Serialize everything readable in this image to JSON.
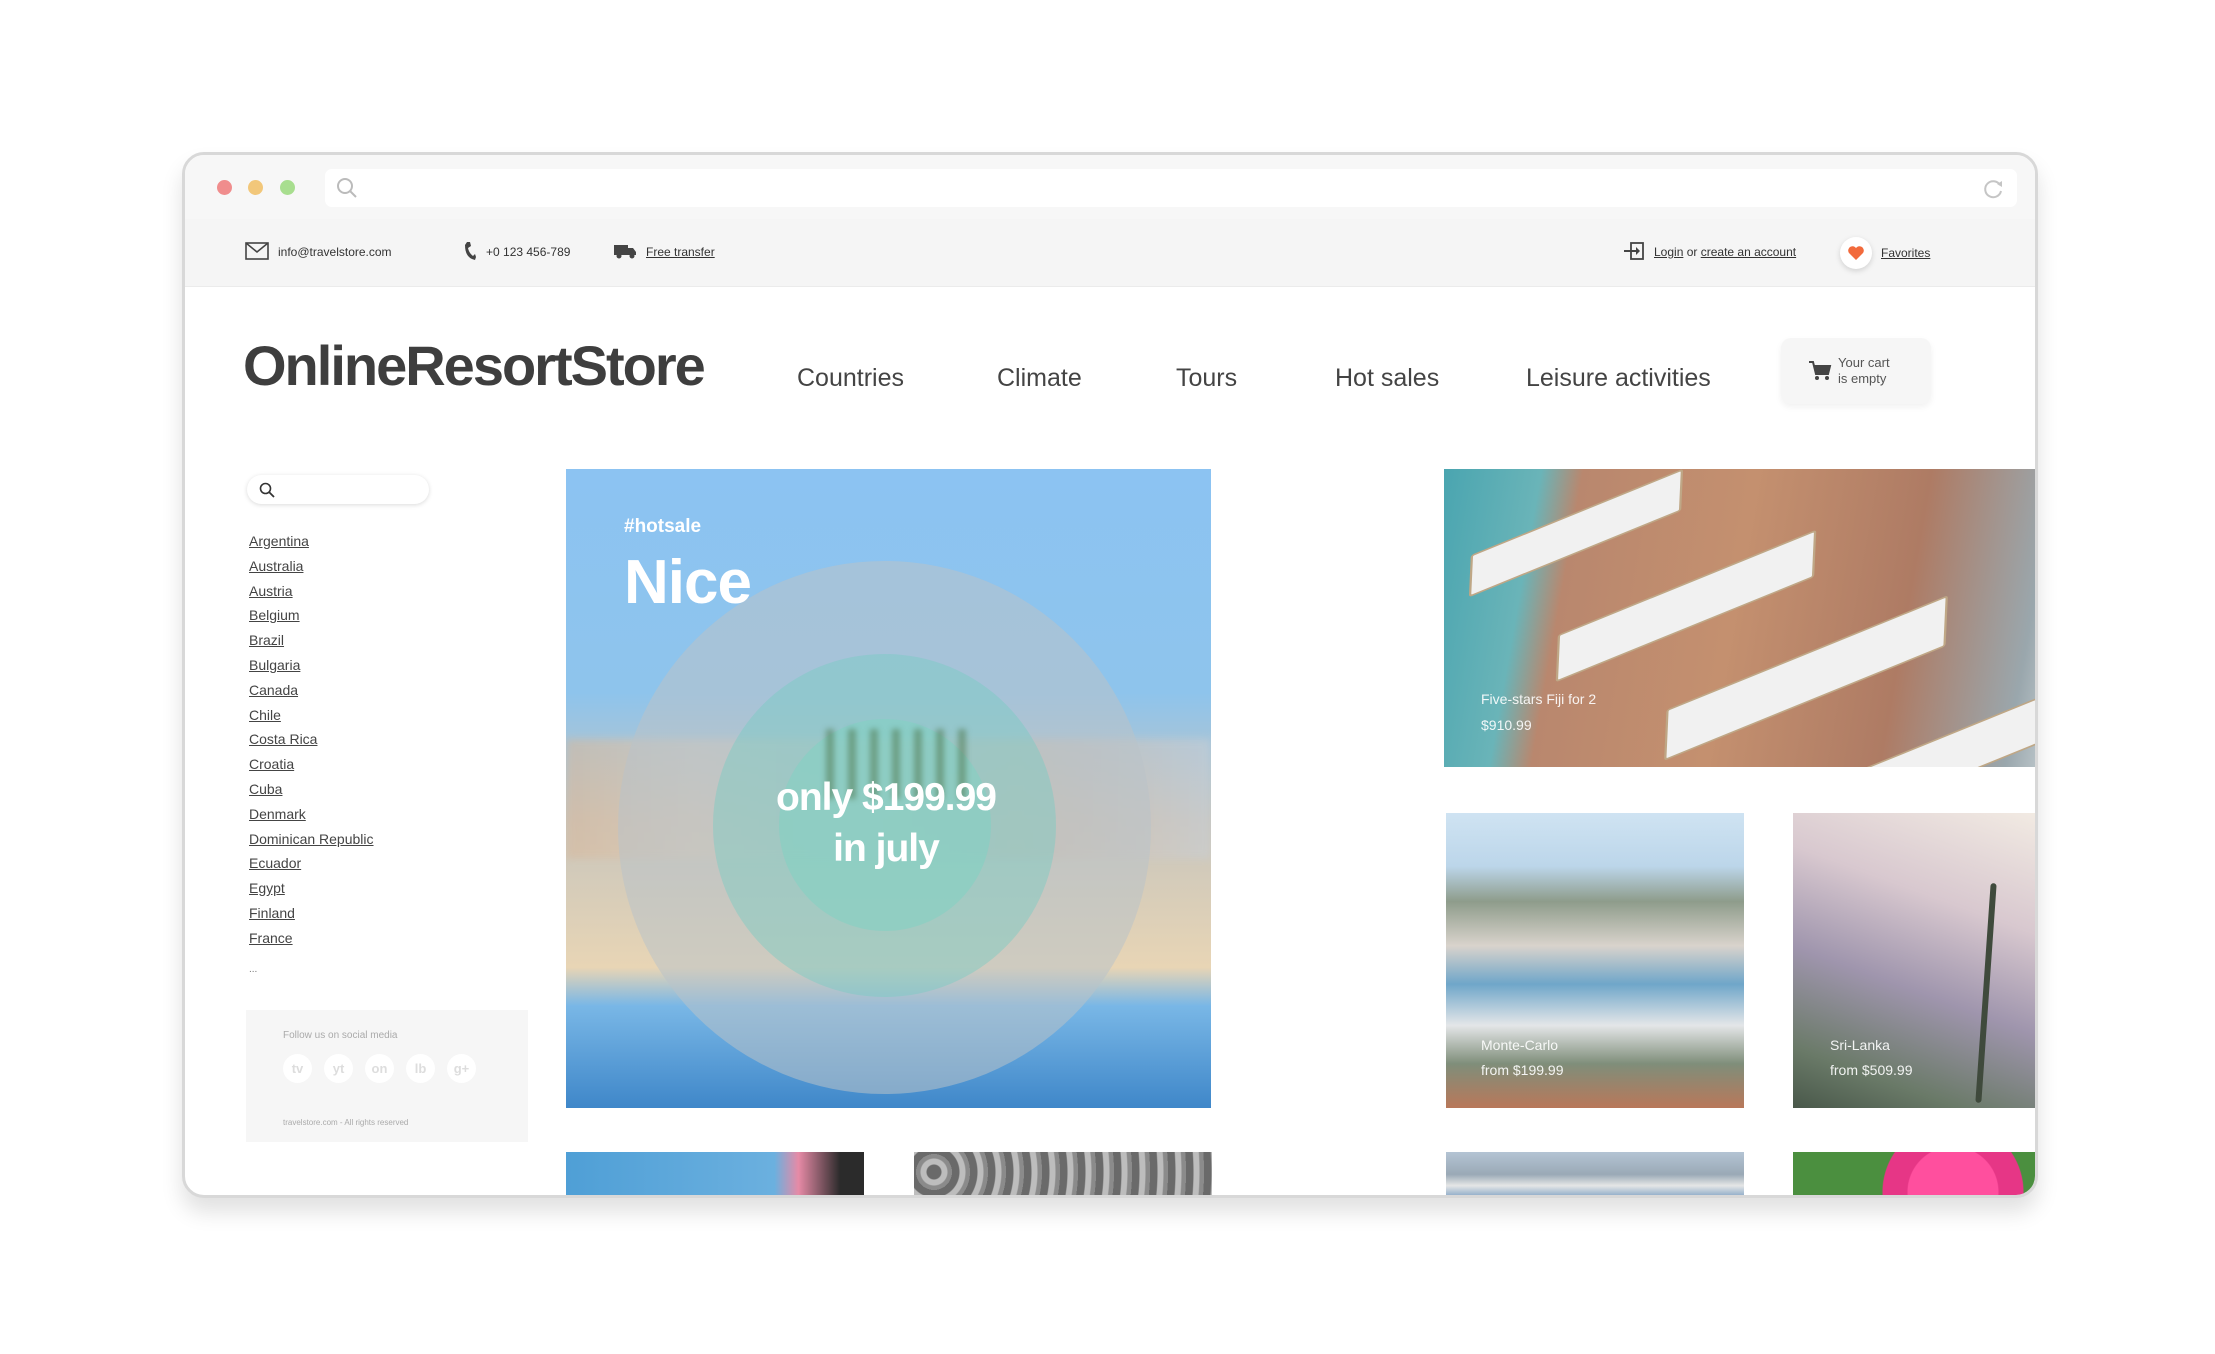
{
  "topbar": {
    "email": "info@travelstore.com",
    "phone": "+0 123 456-789",
    "transfer": "Free transfer",
    "login": "Login",
    "login_or": " or ",
    "create_account": "create an account",
    "favorites": "Favorites"
  },
  "header": {
    "logo": "OnlineResortStore",
    "nav": [
      "Countries",
      "Climate",
      "Tours",
      "Hot sales",
      "Leisure activities"
    ],
    "cart_line1": "Your cart",
    "cart_line2": "is empty"
  },
  "sidebar": {
    "countries": [
      "Argentina",
      "Australia",
      "Austria",
      "Belgium",
      "Brazil",
      "Bulgaria",
      "Canada",
      "Chile",
      "Costa Rica",
      "Croatia",
      "Cuba",
      "Denmark",
      "Dominican Republic",
      "Ecuador",
      "Egypt",
      "Finland",
      "France"
    ],
    "more": "...",
    "social_title": "Follow us on social media",
    "social": [
      "tv",
      "yt",
      "on",
      "lb",
      "g+"
    ],
    "copyright": "travelstore.com - All rights reserved"
  },
  "hero": {
    "tag": "#hotsale",
    "city": "Nice",
    "price_line1": "only $199.99",
    "price_line2": "in july"
  },
  "tiles": [
    {
      "title": "Five-stars Fiji for 2",
      "price": "$910.99"
    },
    {
      "title": "Monte-Carlo",
      "price": "from $199.99"
    },
    {
      "title": "Sri-Lanka",
      "price": "from $509.99"
    }
  ],
  "colors": {
    "favorites_heart": "#f26a3c",
    "dot_red": "#f08d8d",
    "dot_yellow": "#f2c77a",
    "dot_green": "#a8de8f"
  }
}
